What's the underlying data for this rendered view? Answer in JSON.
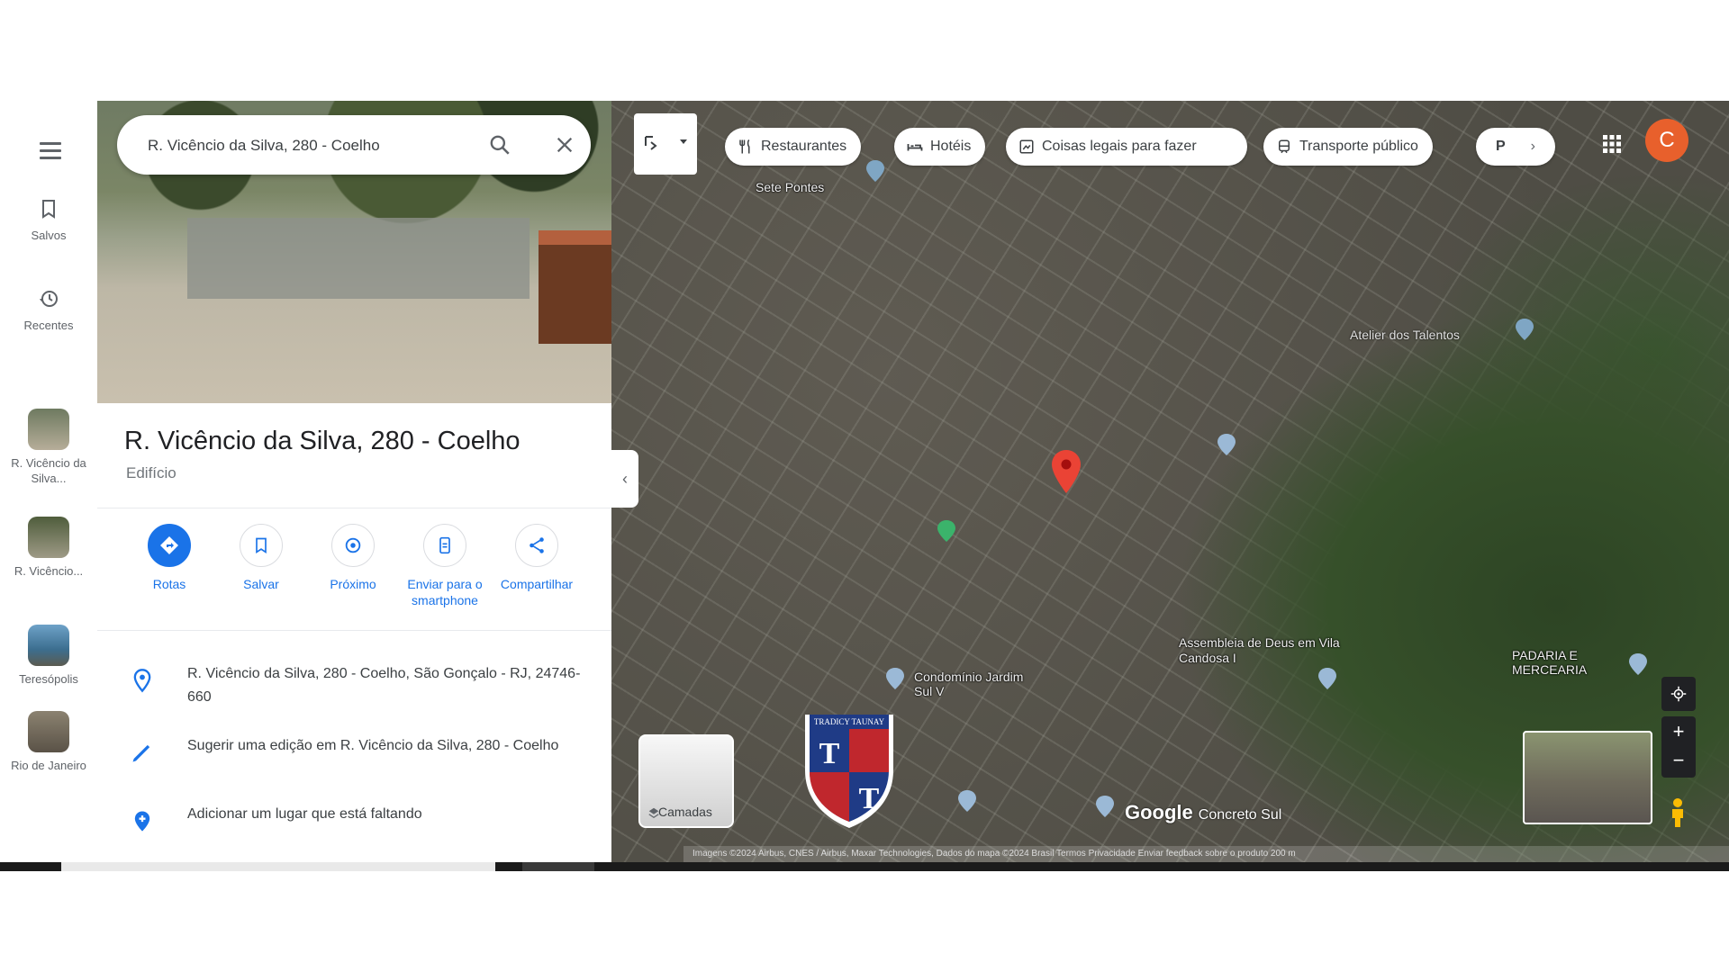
{
  "search": {
    "value": "R. Vicêncio da Silva, 280 - Coelho"
  },
  "rail": {
    "saved": "Salvos",
    "recent": "Recentes",
    "history": [
      {
        "label": "R. Vicêncio da Silva..."
      },
      {
        "label": "R. Vicêncio..."
      },
      {
        "label": "Teresópolis"
      },
      {
        "label": "Rio de Janeiro"
      }
    ]
  },
  "place": {
    "title": "R. Vicêncio da Silva, 280 - Coelho",
    "category": "Edifício",
    "actions": [
      {
        "label": "Rotas",
        "icon": "directions-icon"
      },
      {
        "label": "Salvar",
        "icon": "bookmark-icon"
      },
      {
        "label": "Próximo",
        "icon": "nearby-icon"
      },
      {
        "label": "Enviar para o smartphone",
        "icon": "send-to-phone-icon"
      },
      {
        "label": "Compartilhar",
        "icon": "share-icon"
      }
    ],
    "address": "R. Vicêncio da Silva, 280 - Coelho, São Gonçalo - RJ, 24746-660",
    "suggest_edit": "Sugerir uma edição em R. Vicêncio da Silva, 280 - Coelho",
    "add_place": "Adicionar um lugar que está faltando"
  },
  "map": {
    "chips": [
      {
        "label": "Restaurantes",
        "icon": "restaurant-icon"
      },
      {
        "label": "Hotéis",
        "icon": "hotel-icon"
      },
      {
        "label": "Coisas legais para fazer",
        "icon": "attractions-icon"
      },
      {
        "label": "Transporte público",
        "icon": "transit-icon"
      },
      {
        "label": "P",
        "icon": "parking-icon"
      }
    ],
    "avatar_initial": "C",
    "labels": {
      "area_top": "Sete Pontes",
      "place_right": "Atelier dos Talentos",
      "church": "Assembleia de Deus em Vila Candosa I",
      "condominio": "Condomínio Jardim Sul V",
      "padaria": "PADARIA E MERCEARIA",
      "concreto": "Concreto Sul"
    },
    "layers_label": "Camadas",
    "google": "Google",
    "attribution": "Imagens ©2024 Airbus, CNES / Airbus, Maxar Technologies, Dados do mapa ©2024  Brasil  Termos  Privacidade  Enviar feedback sobre o produto  200 m"
  },
  "logo": {
    "text": "TRADICY TAUNAY",
    "letters": [
      "T",
      "T"
    ]
  }
}
